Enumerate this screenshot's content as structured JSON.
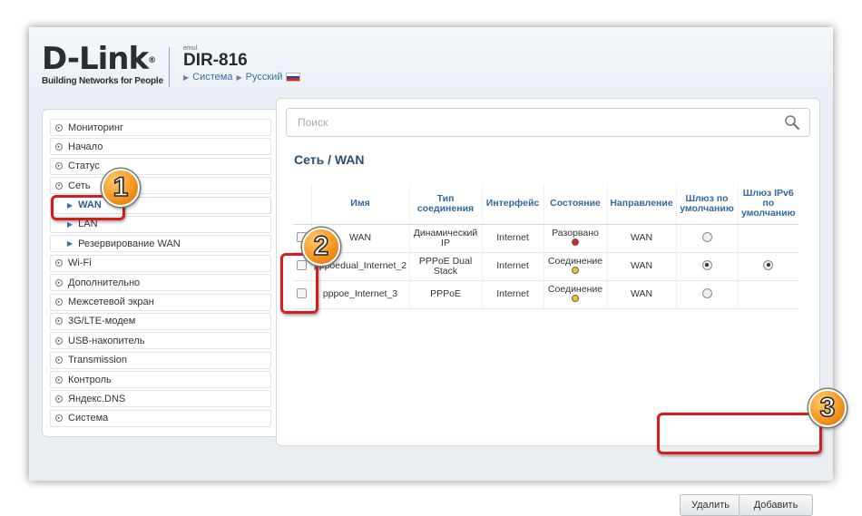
{
  "header": {
    "brand": "D-Link",
    "tagline": "Building Networks for People",
    "emul": "emul",
    "model": "DIR-816",
    "crumb_system": "Система",
    "crumb_lang": "Русский"
  },
  "sidebar": {
    "items": [
      {
        "label": "Мониторинг"
      },
      {
        "label": "Начало"
      },
      {
        "label": "Статус"
      },
      {
        "label": "Сеть"
      },
      {
        "label": "WAN"
      },
      {
        "label": "LAN"
      },
      {
        "label": "Резервирование WAN"
      },
      {
        "label": "Wi-Fi"
      },
      {
        "label": "Дополнительно"
      },
      {
        "label": "Межсетевой экран"
      },
      {
        "label": "3G/LTE-модем"
      },
      {
        "label": "USB-накопитель"
      },
      {
        "label": "Transmission"
      },
      {
        "label": "Контроль"
      },
      {
        "label": "Яндекс.DNS"
      },
      {
        "label": "Система"
      }
    ]
  },
  "search": {
    "placeholder": "Поиск"
  },
  "page": {
    "title": "Сеть /  WAN"
  },
  "table": {
    "headers": {
      "name": "Имя",
      "conn_type": "Тип соединения",
      "iface": "Интерфейс",
      "state": "Состояние",
      "direction": "Направление",
      "gw": "Шлюз по умолчанию",
      "gw6": "Шлюз IPv6 по умолчанию"
    },
    "rows": [
      {
        "name": "WAN",
        "type": "Динамический IP",
        "iface": "Internet",
        "state": "Разорвано",
        "state_color": "#e02020",
        "dir": "WAN",
        "gw": false,
        "gw6": null
      },
      {
        "name": "pppoedual_Internet_2",
        "type": "PPPoE Dual Stack",
        "iface": "Internet",
        "state": "Соединение",
        "state_color": "#f0c419",
        "dir": "WAN",
        "gw": true,
        "gw6": true
      },
      {
        "name": "pppoe_Internet_3",
        "type": "PPPoE",
        "iface": "Internet",
        "state": "Соединение",
        "state_color": "#f0c419",
        "dir": "WAN",
        "gw": false,
        "gw6": null
      }
    ]
  },
  "buttons": {
    "delete": "Удалить",
    "add": "Добавить"
  },
  "callouts": [
    "1",
    "2",
    "3"
  ]
}
